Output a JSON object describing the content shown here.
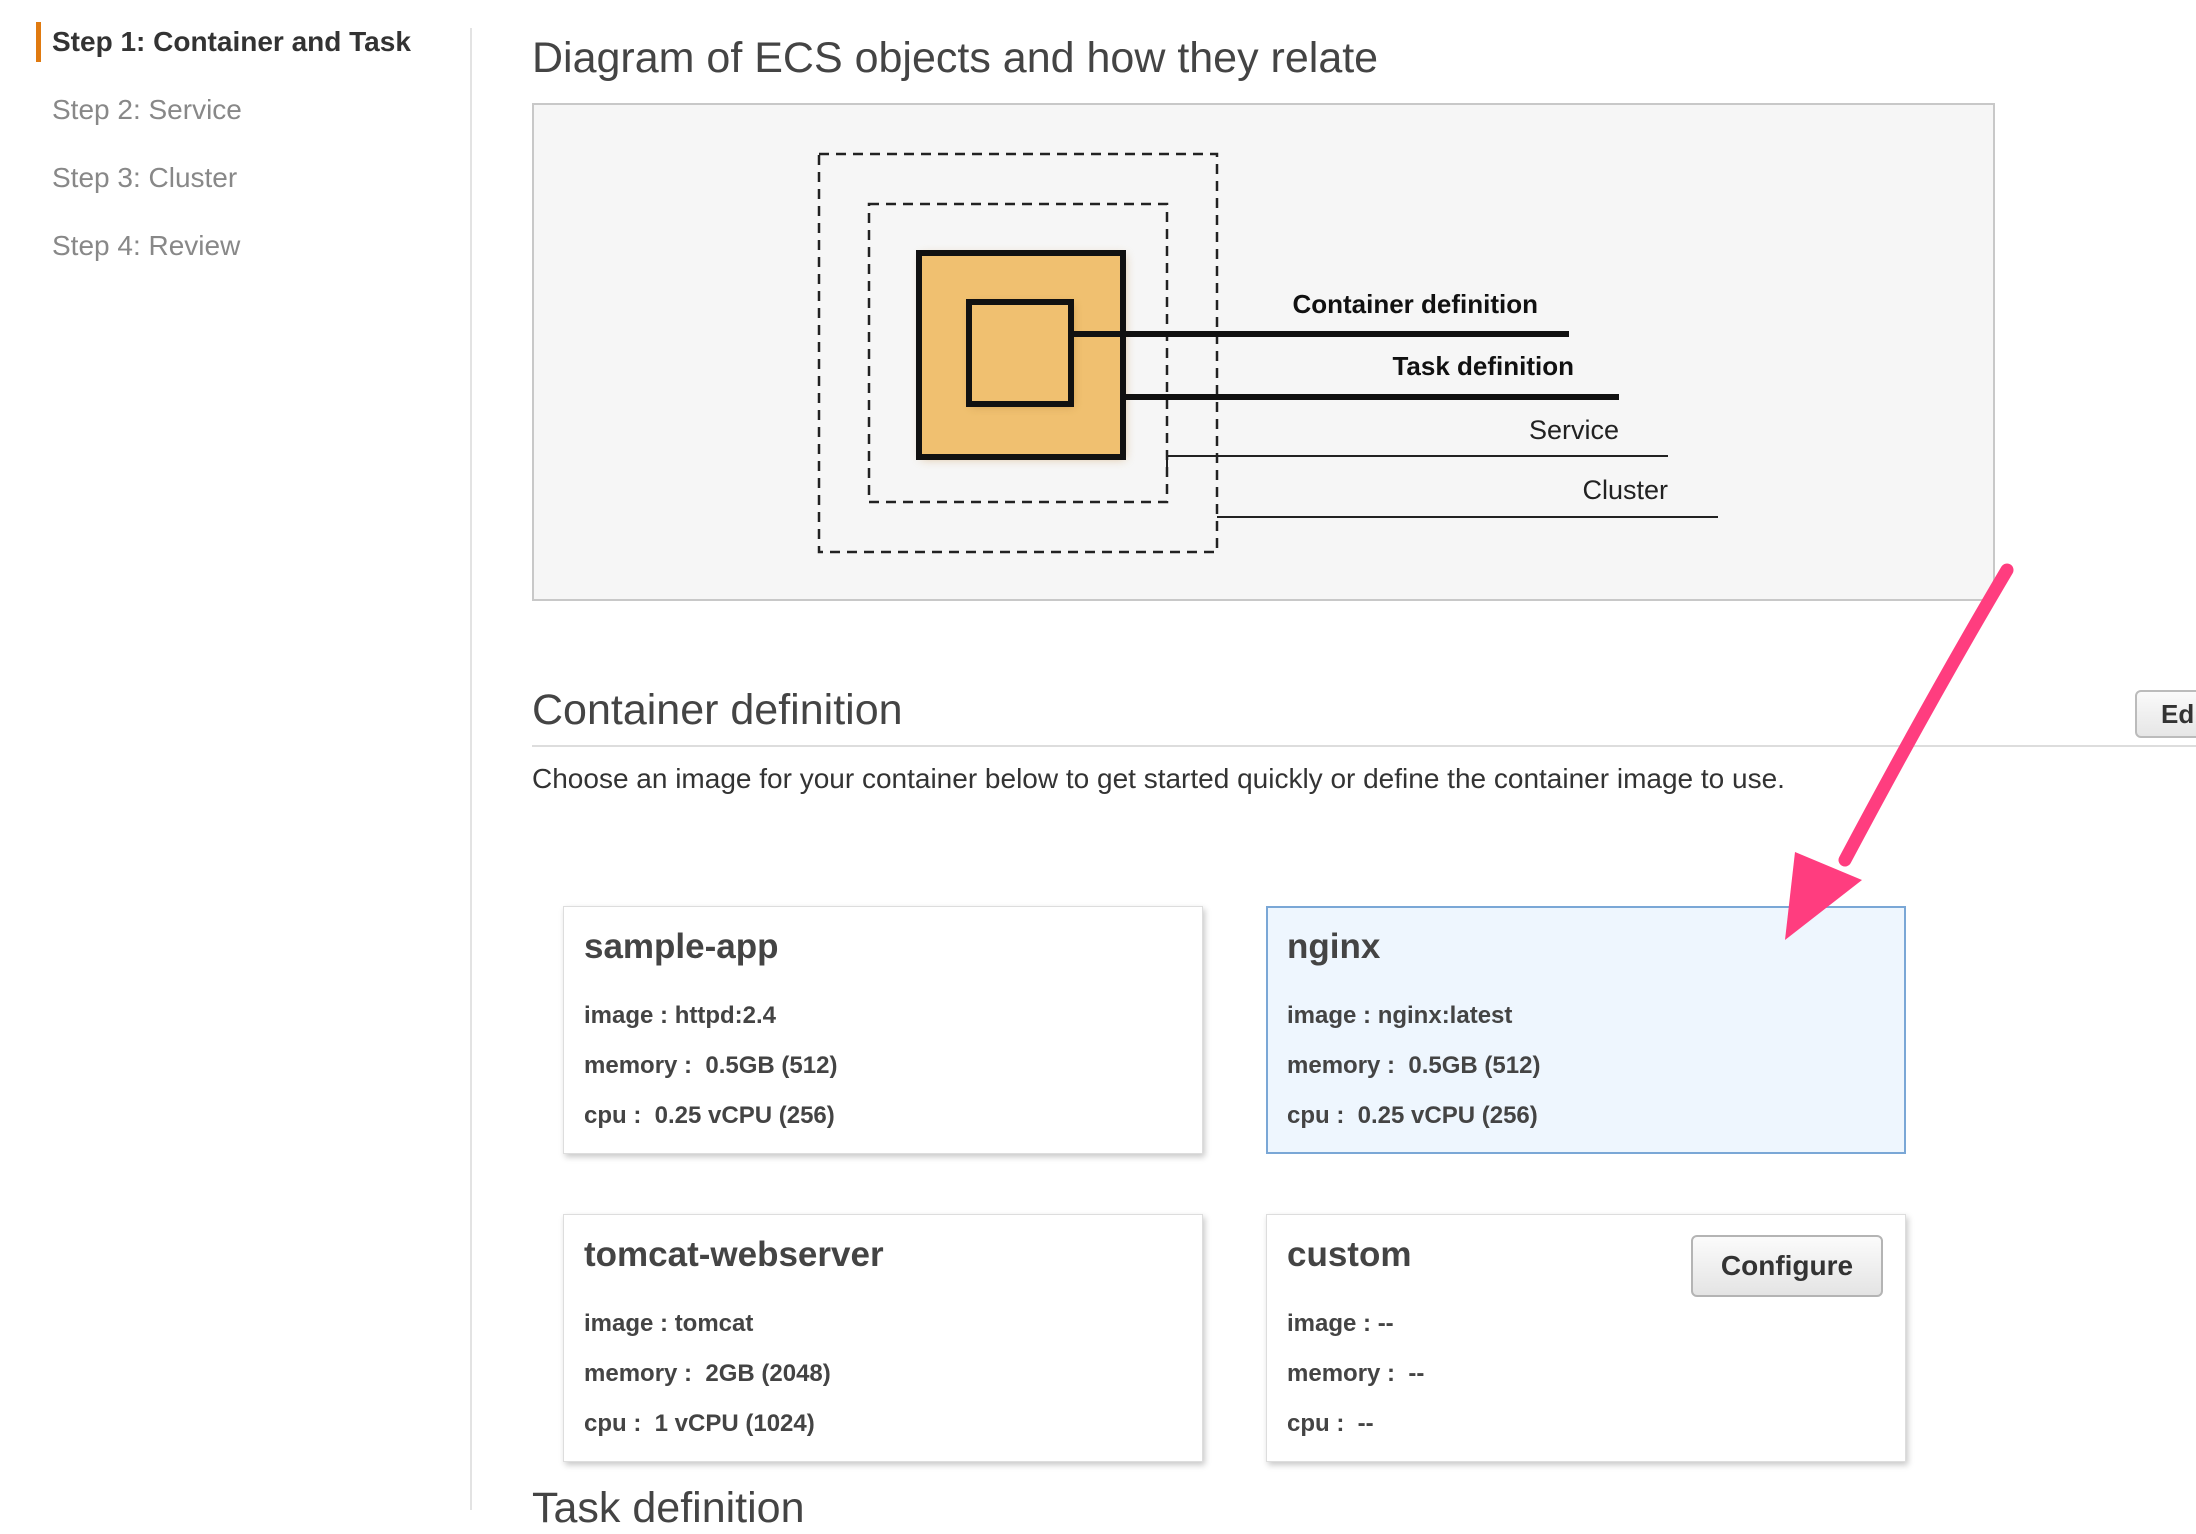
{
  "sidebar": {
    "steps": [
      {
        "label": "Step 1: Container and Task",
        "active": true
      },
      {
        "label": "Step 2: Service",
        "active": false
      },
      {
        "label": "Step 3: Cluster",
        "active": false
      },
      {
        "label": "Step 4: Review",
        "active": false
      }
    ]
  },
  "diagram": {
    "title": "Diagram of ECS objects and how they relate",
    "labels": {
      "container_definition": "Container definition",
      "task_definition": "Task definition",
      "service": "Service",
      "cluster": "Cluster"
    },
    "colors": {
      "task_fill": "#f0c070",
      "background": "#f6f6f6"
    }
  },
  "container_definition": {
    "title": "Container definition",
    "description": "Choose an image for your container below to get started quickly or define the container image to use.",
    "edit_label": "Edit",
    "cards": [
      {
        "name": "sample-app",
        "image": "image : httpd:2.4",
        "memory": "memory :  0.5GB (512)",
        "cpu": "cpu :  0.25 vCPU (256)",
        "selected": false
      },
      {
        "name": "nginx",
        "image": "image : nginx:latest",
        "memory": "memory :  0.5GB (512)",
        "cpu": "cpu :  0.25 vCPU (256)",
        "selected": true
      },
      {
        "name": "tomcat-webserver",
        "image": "image : tomcat",
        "memory": "memory :  2GB (2048)",
        "cpu": "cpu :  1 vCPU (1024)",
        "selected": false
      },
      {
        "name": "custom",
        "image": "image : --",
        "memory": "memory :  --",
        "cpu": "cpu :  --",
        "selected": false,
        "configure_label": "Configure"
      }
    ]
  },
  "next_section": {
    "title": "Task definition"
  },
  "annotation": {
    "arrow_color": "#ff3d7f",
    "arrow_icon": "pointer-arrow-icon"
  }
}
